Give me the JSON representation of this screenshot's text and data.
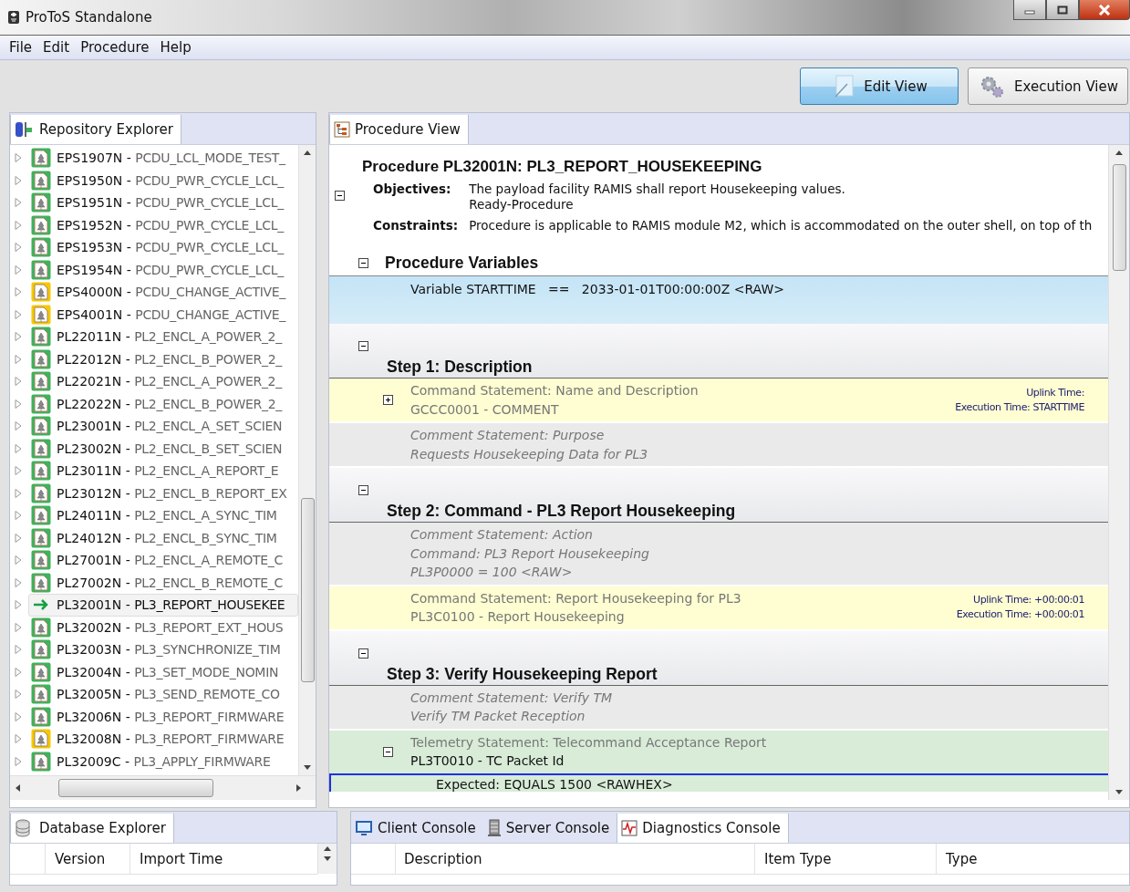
{
  "window": {
    "title": "ProToS Standalone"
  },
  "menu": [
    "File",
    "Edit",
    "Procedure",
    "Help"
  ],
  "view_buttons": [
    {
      "label": "Edit View",
      "selected": true,
      "kind": "edit"
    },
    {
      "label": "Execution View",
      "selected": false,
      "kind": "execution"
    }
  ],
  "repository": {
    "tab": {
      "label": "Repository Explorer",
      "selected": true
    },
    "items": [
      {
        "id": "EPS1907N -",
        "name": "PCDU_LCL_MODE_TEST_",
        "kind": "valid",
        "selected": false
      },
      {
        "id": "EPS1950N -",
        "name": "PCDU_PWR_CYCLE_LCL_",
        "kind": "valid",
        "selected": false
      },
      {
        "id": "EPS1951N -",
        "name": "PCDU_PWR_CYCLE_LCL_",
        "kind": "valid",
        "selected": false
      },
      {
        "id": "EPS1952N -",
        "name": "PCDU_PWR_CYCLE_LCL_",
        "kind": "valid",
        "selected": false
      },
      {
        "id": "EPS1953N -",
        "name": "PCDU_PWR_CYCLE_LCL_",
        "kind": "valid",
        "selected": false
      },
      {
        "id": "EPS1954N -",
        "name": "PCDU_PWR_CYCLE_LCL_",
        "kind": "valid",
        "selected": false
      },
      {
        "id": "EPS4000N -",
        "name": "PCDU_CHANGE_ACTIVE_",
        "kind": "modified",
        "selected": false
      },
      {
        "id": "EPS4001N -",
        "name": "PCDU_CHANGE_ACTIVE_",
        "kind": "modified",
        "selected": false
      },
      {
        "id": "PL22011N -",
        "name": "PL2_ENCL_A_POWER_2_",
        "kind": "valid",
        "selected": false
      },
      {
        "id": "PL22012N -",
        "name": "PL2_ENCL_B_POWER_2_",
        "kind": "valid",
        "selected": false
      },
      {
        "id": "PL22021N -",
        "name": "PL2_ENCL_A_POWER_2_",
        "kind": "valid",
        "selected": false
      },
      {
        "id": "PL22022N -",
        "name": "PL2_ENCL_B_POWER_2_",
        "kind": "valid",
        "selected": false
      },
      {
        "id": "PL23001N -",
        "name": "PL2_ENCL_A_SET_SCIEN",
        "kind": "valid",
        "selected": false
      },
      {
        "id": "PL23002N -",
        "name": "PL2_ENCL_B_SET_SCIEN",
        "kind": "valid",
        "selected": false
      },
      {
        "id": "PL23011N -",
        "name": "PL2_ENCL_A_REPORT_E",
        "kind": "valid",
        "selected": false
      },
      {
        "id": "PL23012N -",
        "name": "PL2_ENCL_B_REPORT_EX",
        "kind": "valid",
        "selected": false
      },
      {
        "id": "PL24011N -",
        "name": "PL2_ENCL_A_SYNC_TIM",
        "kind": "valid",
        "selected": false
      },
      {
        "id": "PL24012N -",
        "name": "PL2_ENCL_B_SYNC_TIM",
        "kind": "valid",
        "selected": false
      },
      {
        "id": "PL27001N -",
        "name": "PL2_ENCL_A_REMOTE_C",
        "kind": "valid",
        "selected": false
      },
      {
        "id": "PL27002N -",
        "name": "PL2_ENCL_B_REMOTE_C",
        "kind": "valid",
        "selected": false
      },
      {
        "id": "PL32001N -",
        "name": "PL3_REPORT_HOUSEKEE",
        "kind": "open",
        "selected": true
      },
      {
        "id": "PL32002N -",
        "name": "PL3_REPORT_EXT_HOUS",
        "kind": "valid",
        "selected": false
      },
      {
        "id": "PL32003N -",
        "name": "PL3_SYNCHRONIZE_TIM",
        "kind": "valid",
        "selected": false
      },
      {
        "id": "PL32004N -",
        "name": "PL3_SET_MODE_NOMIN",
        "kind": "valid",
        "selected": false
      },
      {
        "id": "PL32005N -",
        "name": "PL3_SEND_REMOTE_CO",
        "kind": "valid",
        "selected": false
      },
      {
        "id": "PL32006N -",
        "name": "PL3_REPORT_FIRMWARE",
        "kind": "valid",
        "selected": false
      },
      {
        "id": "PL32008N -",
        "name": "PL3_REPORT_FIRMWARE",
        "kind": "modified",
        "selected": false
      },
      {
        "id": "PL32009C -",
        "name": "PL3_APPLY_FIRMWARE",
        "kind": "valid",
        "selected": false
      }
    ]
  },
  "procedure_view": {
    "tab": {
      "label": "Procedure View",
      "selected": true
    },
    "title": "Procedure PL32001N: PL3_REPORT_HOUSEKEEPING",
    "header_expanded": true,
    "objectives_label": "Objectives:",
    "objectives": [
      "The payload facility RAMIS shall report Housekeeping values.",
      "Ready-Procedure"
    ],
    "constraints_label": "Constraints:",
    "constraints": "Procedure is applicable to RAMIS module M2, which is accommodated on the outer shell, on top of th",
    "variables": {
      "heading": "Procedure Variables",
      "expanded": true,
      "items": [
        "Variable STARTTIME   ==   2033-01-01T00:00:00Z <RAW>"
      ]
    },
    "steps": [
      {
        "heading": "Step 1: Description",
        "expanded": true,
        "statements": [
          {
            "kind": "command",
            "expanded": false,
            "lines": [
              "Command Statement: Name and Description",
              "GCCC0001 - COMMENT"
            ],
            "uplink": "Uplink Time:",
            "execution": "Execution Time: STARTTIME"
          },
          {
            "kind": "comment",
            "lines": [
              "Comment Statement: Purpose",
              "Requests Housekeeping Data for PL3"
            ]
          }
        ]
      },
      {
        "heading": "Step 2: Command -  PL3 Report Housekeeping",
        "expanded": true,
        "statements": [
          {
            "kind": "comment",
            "lines": [
              "Comment Statement: Action",
              "Command: PL3 Report Housekeeping",
              "PL3P0000 = 100 <RAW>"
            ]
          },
          {
            "kind": "command",
            "lines": [
              "Command Statement: Report Housekeeping for PL3",
              "PL3C0100 - Report Housekeeping"
            ],
            "uplink": "Uplink Time: +00:00:01",
            "execution": "Execution Time: +00:00:01"
          }
        ]
      },
      {
        "heading": "Step 3: Verify Housekeeping Report",
        "expanded": true,
        "statements": [
          {
            "kind": "comment",
            "lines": [
              "Comment Statement: Verify TM",
              "Verify TM Packet Reception"
            ]
          },
          {
            "kind": "telemetry",
            "expanded": true,
            "lines": [
              "Telemetry Statement: Telecommand Acceptance Report",
              "PL3T0010 - TC Packet Id"
            ],
            "expected": "Expected:  EQUALS  1500 <RAWHEX>"
          }
        ]
      }
    ]
  },
  "database": {
    "tab": {
      "label": "Database Explorer",
      "selected": true
    },
    "columns": [
      "Version",
      "Import Time"
    ]
  },
  "consoles": {
    "tabs": [
      {
        "label": "Client Console",
        "kind": "client",
        "selected": false
      },
      {
        "label": "Server Console",
        "kind": "server",
        "selected": false
      },
      {
        "label": "Diagnostics Console",
        "kind": "diagnostics",
        "selected": true
      }
    ],
    "columns": [
      "Description",
      "Item Type",
      "Type"
    ]
  }
}
